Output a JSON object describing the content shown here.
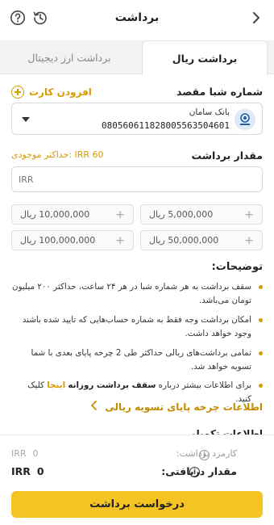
{
  "header": {
    "title": "برداشت"
  },
  "tabs": {
    "rial": "برداشت ریال",
    "crypto": "برداشت ارز دیجیتال"
  },
  "iban": {
    "label": "شماره شبا مقصد",
    "add_card": "افزودن کارت",
    "bank_name": "بانک سامان",
    "number": "080560611828005563504601"
  },
  "amount": {
    "label": "مقدار برداشت",
    "max_balance": "حداکثر موجودی: IRR 60",
    "placeholder": "IRR"
  },
  "presets": [
    {
      "label": "5,000,000 ریال"
    },
    {
      "label": "10,000,000 ریال"
    },
    {
      "label": "50,000,000 ریال"
    },
    {
      "label": "100,000,000 ریال"
    }
  ],
  "descriptions": {
    "title": "توضیحات:",
    "item1": "سقف برداشت به هر شماره شبا در هر ۲۴ ساعت، حداکثر ۲۰۰ میلیون تومان می‌باشد.",
    "item2": "امکان برداشت وجه فقط به شماره حساب‌هایی که تایید شده باشند وجود خواهد داشت.",
    "item3": "تمامی برداشت‌های ریالی حداکثر طی 2 چرخه پایای بعدی با شما تسویه خواهد شد.",
    "item4_prefix": "برای اطلاعات بیشتر درباره",
    "item4_bold": "سقف برداشت روزانه",
    "item4_link": "اینجا",
    "item4_suffix": "کلیک کنید."
  },
  "cycle_link": "اطلاعات چرخه پایای تسویه ریالی",
  "cut_heading": "اطلاعات تکمیلی",
  "summary": {
    "fee_label": "کارمزد برداشت:",
    "fee_currency": "IRR",
    "fee_value": "0",
    "received_label": "مقدار دریافتی:",
    "received_currency": "IRR",
    "received_value": "0"
  },
  "submit": "درخواست برداشت",
  "colors": {
    "accent": "#f5c324",
    "accent_text": "#d99a00"
  }
}
